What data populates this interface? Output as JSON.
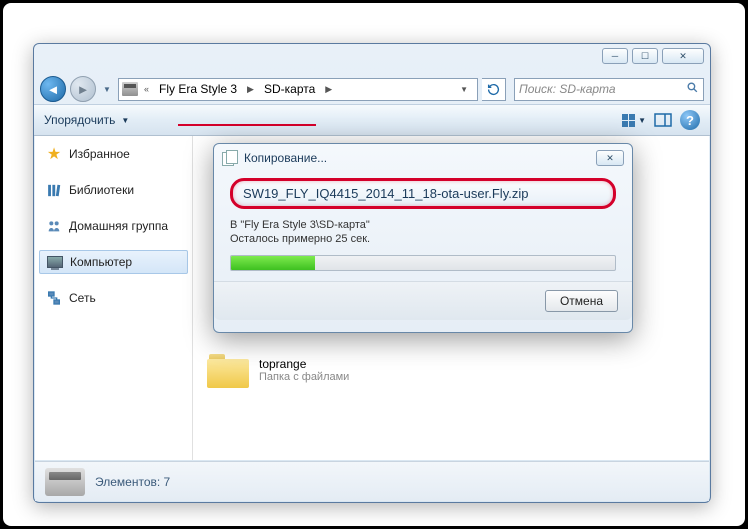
{
  "breadcrumb": {
    "seg1": "Fly Era Style 3",
    "seg2": "SD-карта"
  },
  "search": {
    "placeholder": "Поиск: SD-карта"
  },
  "toolbar": {
    "organize": "Упорядочить"
  },
  "sidebar": {
    "items": [
      {
        "label": "Избранное"
      },
      {
        "label": "Библиотеки"
      },
      {
        "label": "Домашняя группа"
      },
      {
        "label": "Компьютер"
      },
      {
        "label": "Сеть"
      }
    ]
  },
  "content": {
    "folders": [
      {
        "name": "toprange",
        "sub": "Папка с файлами"
      }
    ]
  },
  "status": {
    "text": "Элементов: 7"
  },
  "dialog": {
    "title": "Копирование...",
    "filename": "SW19_FLY_IQ4415_2014_11_18-ota-user.Fly.zip",
    "dest": "В \"Fly Era Style 3\\SD-карта\"",
    "remaining": "Осталось примерно 25 сек.",
    "cancel": "Отмена",
    "progress_pct": 22
  }
}
